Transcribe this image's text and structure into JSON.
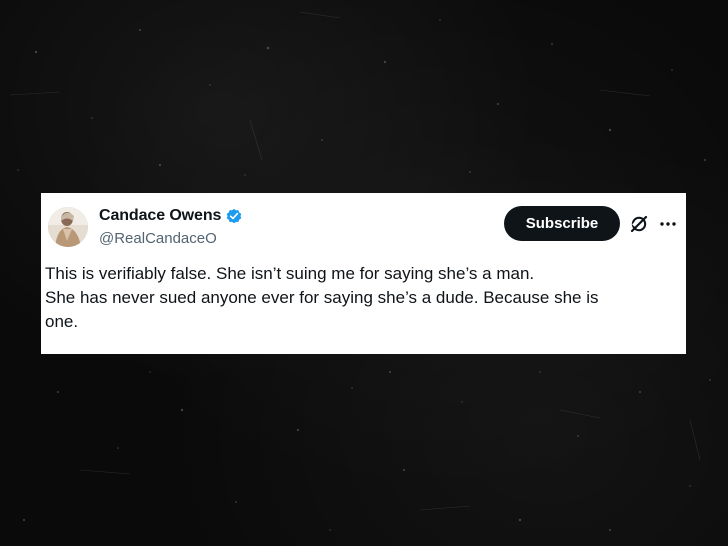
{
  "tweet": {
    "author": {
      "display_name": "Candace Owens",
      "handle": "@RealCandaceO",
      "verified_icon": "verified-badge-icon",
      "avatar_icon": "avatar"
    },
    "actions": {
      "subscribe_label": "Subscribe",
      "grok_icon": "grok-icon",
      "more_icon": "more-options-icon"
    },
    "body_lines": [
      "This is verifiably false. She isn’t suing me for saying she’s a man.",
      "She has never sued anyone ever for saying she’s a dude. Because she is",
      "one."
    ]
  },
  "colors": {
    "background": "#0a0a0a",
    "card": "#ffffff",
    "text": "#0f1419",
    "muted": "#536471",
    "verified": "#1d9bf0",
    "button": "#0f1419"
  }
}
